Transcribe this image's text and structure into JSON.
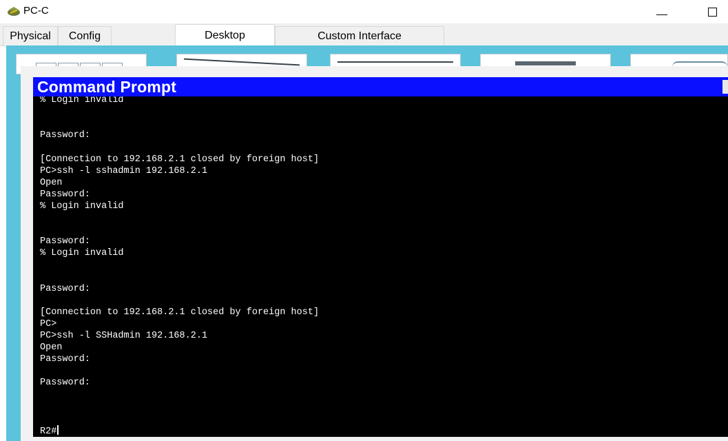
{
  "window": {
    "title": "PC-C",
    "icon": "router-pc-icon"
  },
  "tabs": [
    {
      "label": "Physical",
      "active": false
    },
    {
      "label": "Config",
      "active": false
    },
    {
      "label": "Desktop",
      "active": true
    },
    {
      "label": "Custom Interface",
      "active": false
    }
  ],
  "command_prompt": {
    "title": "Command Prompt",
    "lines": [
      "% Login invalid",
      "",
      "",
      "Password:",
      "",
      "[Connection to 192.168.2.1 closed by foreign host]",
      "PC>ssh -l sshadmin 192.168.2.1",
      "Open",
      "Password:",
      "% Login invalid",
      "",
      "",
      "Password:",
      "% Login invalid",
      "",
      "",
      "Password:",
      "",
      "[Connection to 192.168.2.1 closed by foreign host]",
      "PC>",
      "PC>ssh -l SSHadmin 192.168.2.1",
      "Open",
      "Password:",
      "",
      "Password:",
      "",
      "",
      "",
      "R2#"
    ]
  },
  "colors": {
    "desktop_bg": "#5bc3dc",
    "cmd_title_bg": "#0a10ff",
    "terminal_bg": "#000000",
    "terminal_fg": "#ffffff"
  }
}
